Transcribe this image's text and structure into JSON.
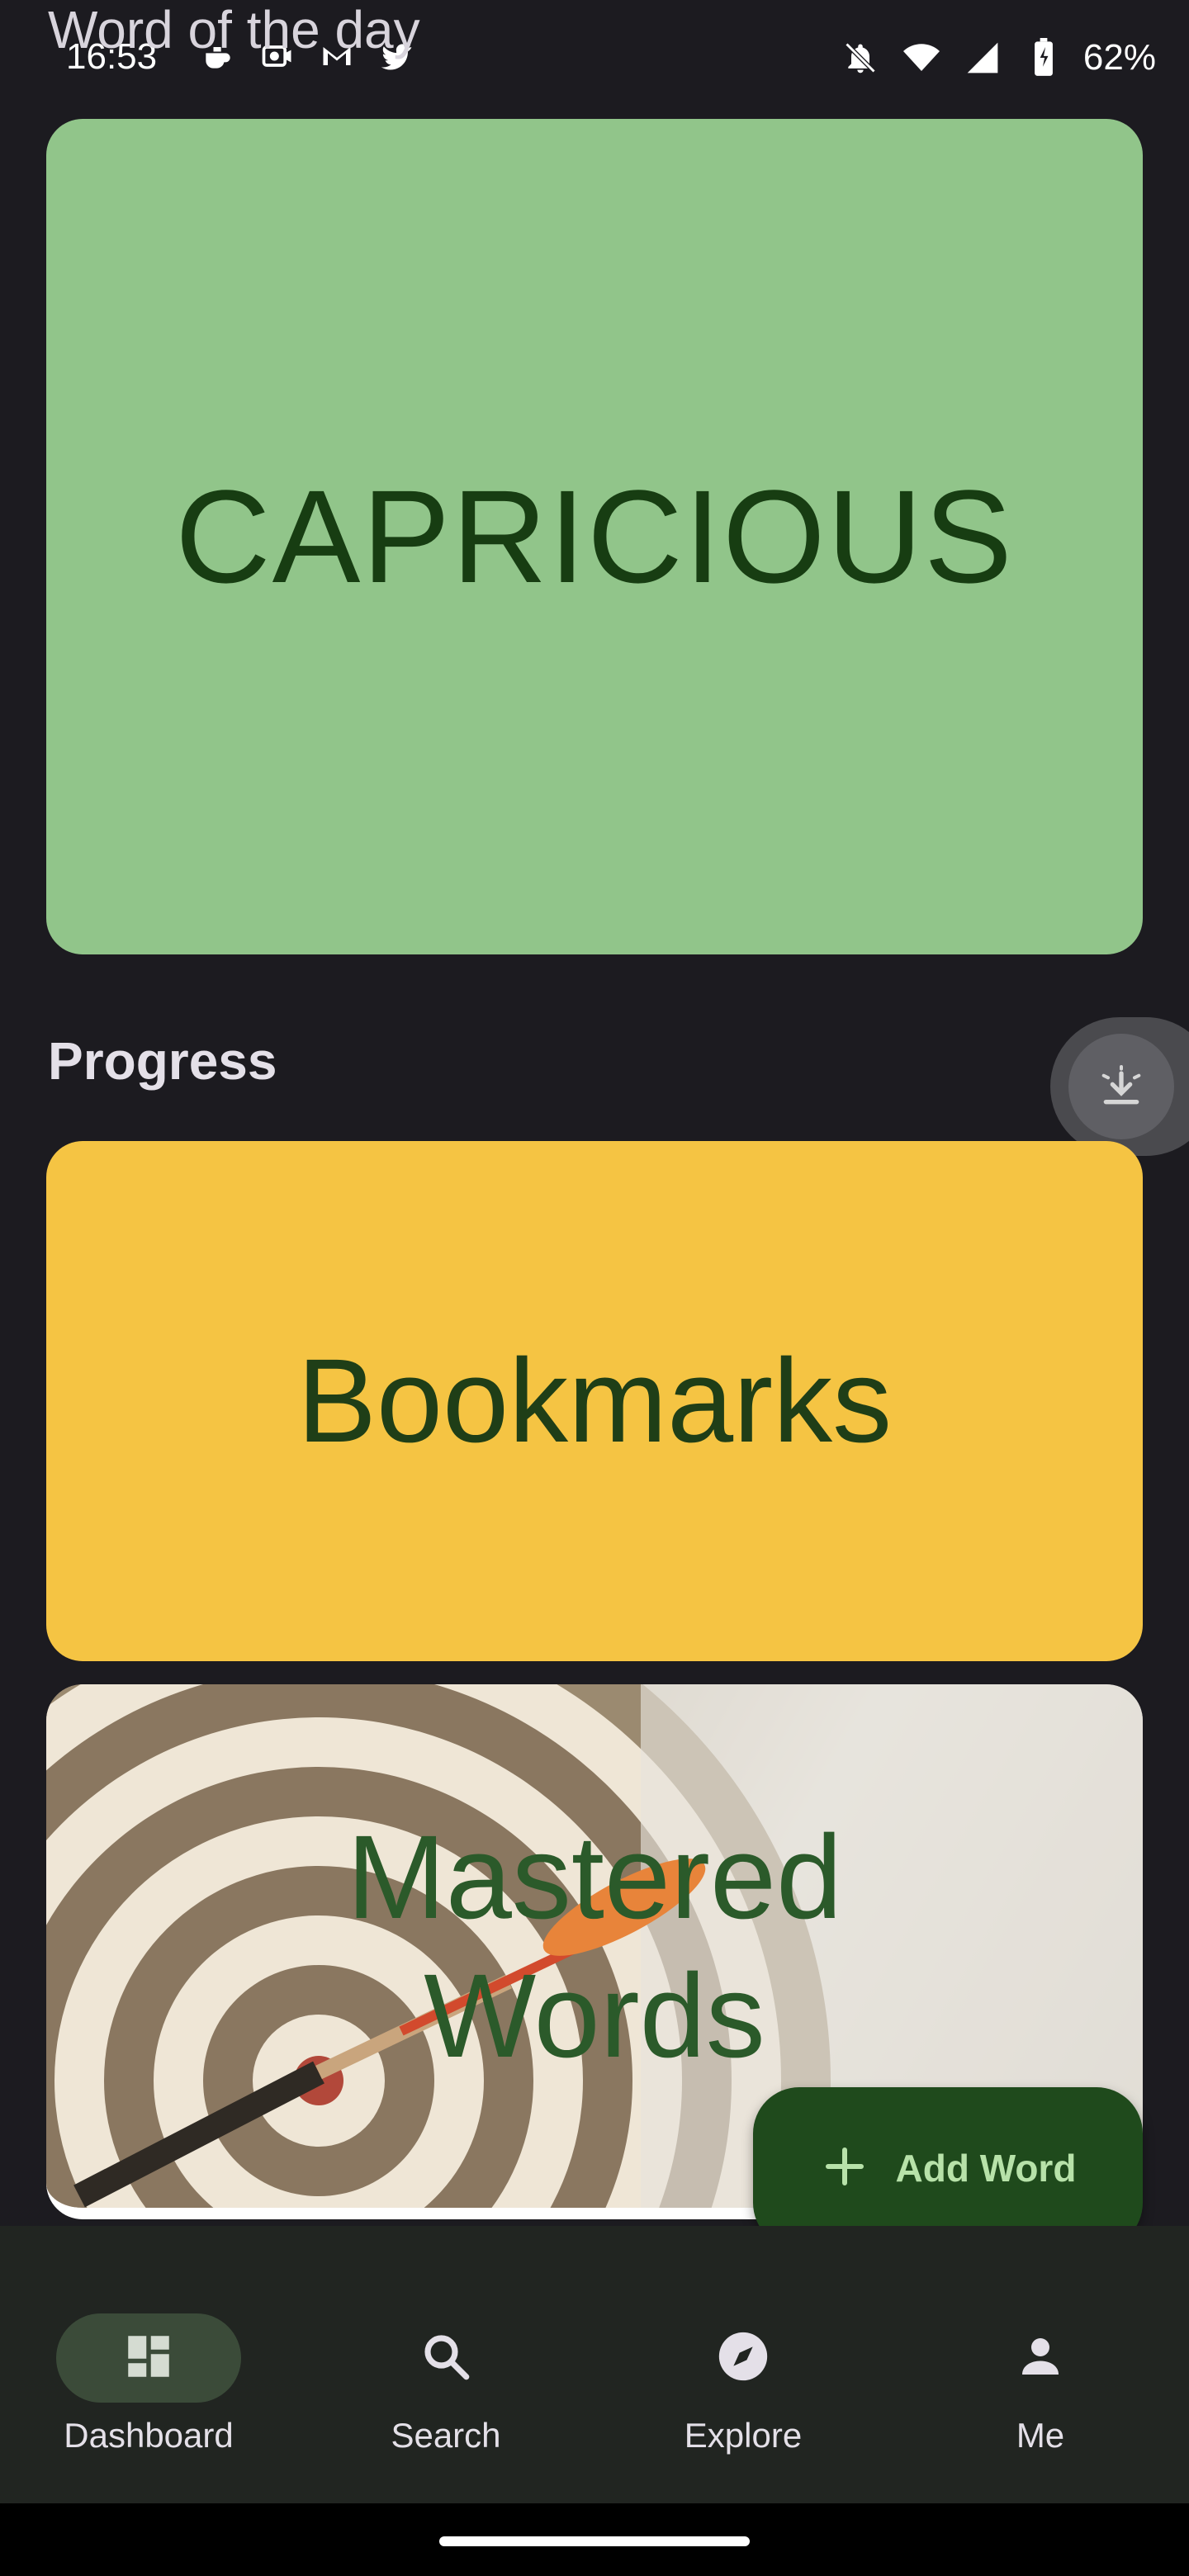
{
  "status_bar": {
    "time": "16:53",
    "left_icons": [
      "teapot-icon",
      "camera-icon",
      "gmail-icon",
      "twitter-icon"
    ],
    "right_icons": [
      "silent-bell-icon",
      "wifi-icon",
      "signal-icon",
      "battery-charging-icon"
    ],
    "battery": "62%"
  },
  "sections": {
    "word_of_day_title": "Word of the day",
    "progress_title": "Progress"
  },
  "word_of_day": {
    "word": "CAPRICIOUS"
  },
  "progress_cards": {
    "bookmarks": "Bookmarks",
    "mastered_line1": "Mastered",
    "mastered_line2": "Words"
  },
  "fab": {
    "label": "Add Word",
    "icon": "plus-icon"
  },
  "bottom_nav": {
    "items": [
      {
        "label": "Dashboard",
        "icon": "dashboard-icon",
        "active": true
      },
      {
        "label": "Search",
        "icon": "search-icon",
        "active": false
      },
      {
        "label": "Explore",
        "icon": "compass-icon",
        "active": false
      },
      {
        "label": "Me",
        "icon": "person-icon",
        "active": false
      }
    ]
  },
  "colors": {
    "background": "#1c1b20",
    "word_card": "#91c58a",
    "bookmarks_card": "#f5c443",
    "fab": "#1f4a1c",
    "nav_bg": "#212521"
  }
}
